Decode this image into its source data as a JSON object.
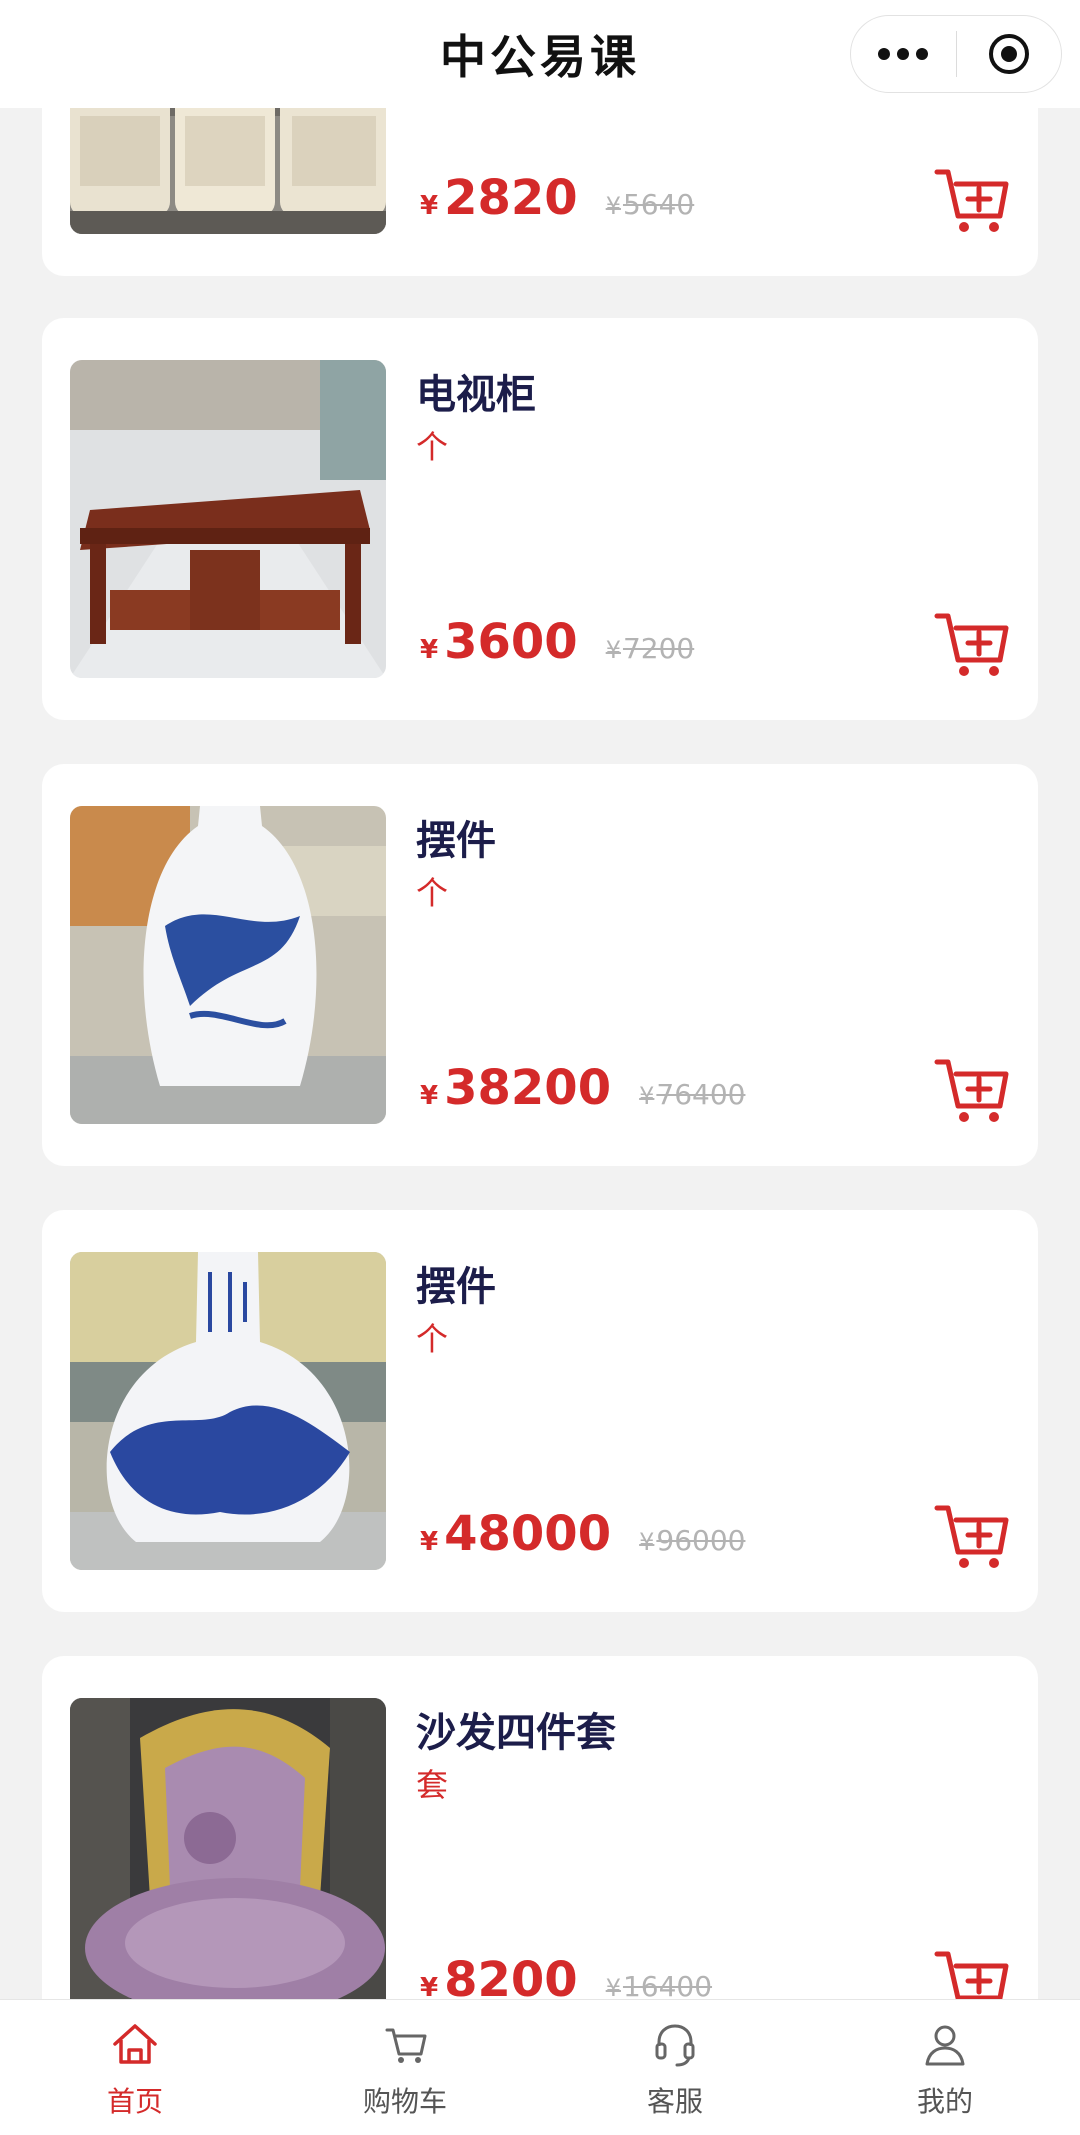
{
  "header": {
    "title": "中公易课"
  },
  "products": [
    {
      "name": "",
      "unit": "",
      "currency": "¥",
      "price": "2820",
      "original_price": "5640",
      "image": "armchairs"
    },
    {
      "name": "电视柜",
      "unit": "个",
      "currency": "¥",
      "price": "3600",
      "original_price": "7200",
      "image": "wooden-tv-cabinet"
    },
    {
      "name": "摆件",
      "unit": "个",
      "currency": "¥",
      "price": "38200",
      "original_price": "76400",
      "image": "blue-white-porcelain-vase"
    },
    {
      "name": "摆件",
      "unit": "个",
      "currency": "¥",
      "price": "48000",
      "original_price": "96000",
      "image": "blue-white-porcelain-globular-vase"
    },
    {
      "name": "沙发四件套",
      "unit": "套",
      "currency": "¥",
      "price": "8200",
      "original_price": "16400",
      "image": "purple-ornate-sofa"
    }
  ],
  "tabbar": {
    "items": [
      {
        "label": "首页",
        "icon": "home-icon",
        "active": true
      },
      {
        "label": "购物车",
        "icon": "cart-icon",
        "active": false
      },
      {
        "label": "客服",
        "icon": "headset-icon",
        "active": false
      },
      {
        "label": "我的",
        "icon": "user-icon",
        "active": false
      }
    ]
  },
  "colors": {
    "accent": "#d42a2a",
    "title_text": "#1c1d4a",
    "background": "#f2f2f2"
  }
}
